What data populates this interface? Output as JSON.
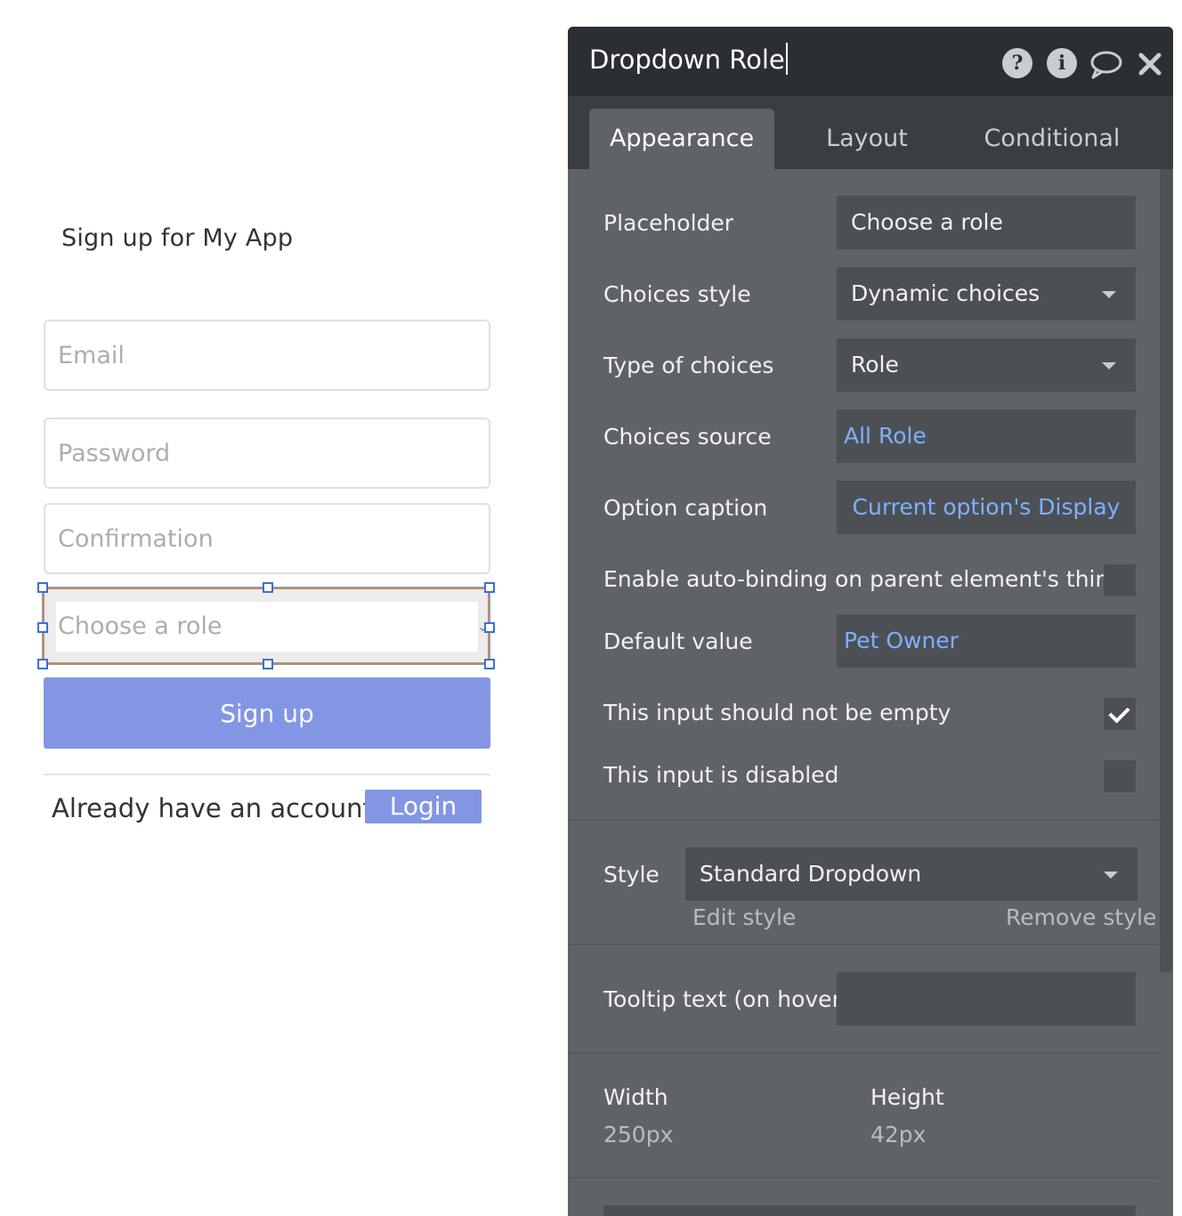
{
  "canvas": {
    "form_title": "Sign up for My App",
    "email_placeholder": "Email",
    "password_placeholder": "Password",
    "confirmation_placeholder": "Confirmation",
    "role_dropdown_placeholder": "Choose a role",
    "signup_label": "Sign up",
    "already_text": "Already have an account?",
    "login_label": "Login"
  },
  "panel": {
    "title": "Dropdown Role",
    "header_icons": [
      "help-icon",
      "info-icon",
      "comment-icon",
      "close-icon"
    ],
    "tabs": [
      {
        "label": "Appearance",
        "active": true
      },
      {
        "label": "Layout",
        "active": false
      },
      {
        "label": "Conditional",
        "active": false
      }
    ],
    "placeholder": {
      "label": "Placeholder",
      "value": "Choose a role"
    },
    "choices_style": {
      "label": "Choices style",
      "value": "Dynamic choices"
    },
    "type_of_choices": {
      "label": "Type of choices",
      "value": "Role"
    },
    "choices_source": {
      "label": "Choices source",
      "value": "All Role"
    },
    "option_caption": {
      "label": "Option caption",
      "value": "Current option's Display"
    },
    "auto_binding": {
      "label": "Enable auto-binding on parent element's thing",
      "checked": false
    },
    "default_value": {
      "label": "Default value",
      "value": "Pet Owner"
    },
    "not_empty": {
      "label": "This input should not be empty",
      "checked": true
    },
    "disabled": {
      "label": "This input is disabled",
      "checked": false
    },
    "style": {
      "label": "Style",
      "value": "Standard Dropdown",
      "edit_label": "Edit style",
      "remove_label": "Remove style"
    },
    "tooltip": {
      "label": "Tooltip text (on hover)",
      "value": ""
    },
    "width": {
      "label": "Width",
      "value": "250px"
    },
    "height": {
      "label": "Height",
      "value": "42px"
    },
    "colors": {
      "panel_bg": "#5f6368",
      "header_bg": "#2b2f33",
      "link": "#7fb0ff",
      "button": "#8396e3"
    }
  }
}
